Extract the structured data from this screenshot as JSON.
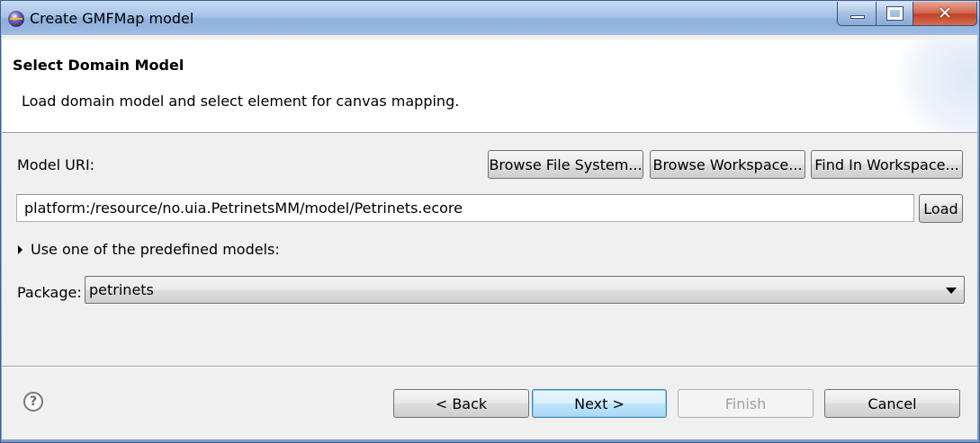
{
  "window": {
    "title": "Create GMFMap model",
    "close_glyph": "✕"
  },
  "header": {
    "title": "Select Domain Model",
    "description": "Load domain model and select element for canvas mapping."
  },
  "model_uri": {
    "label": "Model URI:",
    "value": "platform:/resource/no.uia.PetrinetsMM/model/Petrinets.ecore",
    "browse_file_system": "Browse File System...",
    "browse_workspace": "Browse Workspace...",
    "find_in_workspace": "Find In Workspace...",
    "load": "Load"
  },
  "predefined": {
    "label": "Use one of the predefined models:",
    "expanded": false
  },
  "package": {
    "label": "Package:",
    "selected": "petrinets"
  },
  "footer": {
    "help_glyph": "?",
    "back": "< Back",
    "next": "Next >",
    "finish": "Finish",
    "cancel": "Cancel"
  }
}
